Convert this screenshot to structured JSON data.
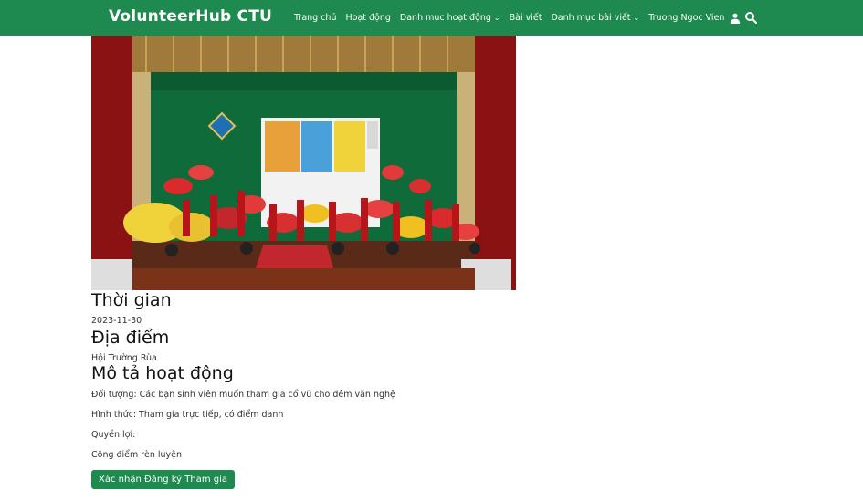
{
  "header": {
    "brand": "VolunteerHub CTU",
    "nav": {
      "home": "Trang chủ",
      "activities": "Hoạt động",
      "activity_categories": "Danh mục hoạt động",
      "posts": "Bài viết",
      "post_categories": "Danh mục bài viết",
      "user_name": "Truong Ngoc Vien"
    },
    "icons": {
      "user": "user-icon",
      "search": "search-icon",
      "dropdown": "chevron-down-icon"
    }
  },
  "event": {
    "time_heading": "Thời gian",
    "date": "2023-11-30",
    "location_heading": "Địa điểm",
    "location": "Hội Trường Rùa",
    "description_heading": "Mô tả hoạt động",
    "audience": "Đối tượng: Các bạn sinh viên muốn tham gia cổ vũ cho đêm văn nghệ",
    "format": "Hình thức: Tham gia trực tiếp, có điểm danh",
    "benefits_label": "Quyền lợi:",
    "benefits": "Cộng điểm rèn luyện",
    "register_button": "Xác nhận Đăng ký Tham gia"
  },
  "colors": {
    "primary": "#1e8a4f",
    "curtain": "#8a1212",
    "stage_green": "#0f6b3a"
  }
}
